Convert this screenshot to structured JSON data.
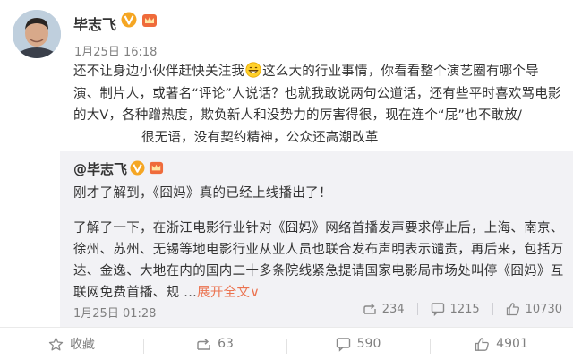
{
  "post": {
    "author": "毕志飞",
    "time": "1月25日 16:18",
    "text_part1": "还不让身边小伙伴赶快关注我",
    "text_part2": "这么大的行业事情，你看看整个演艺圈有哪个导演、制片人，或著名“评论”人说话？也就我敢说两句公道话，还有些平时喜欢骂电影的大V，各种蹭热度，欺负新人和没势力的厉害得很，现在连个“屁”也不敢放/",
    "text_part3": "很无语，没有契约精神，公众还高潮改革",
    "emoji": "grin-emoji"
  },
  "repost": {
    "author": "@毕志飞",
    "line1": "刚才了解到，《囧妈》真的已经上线播出了！",
    "paragraph": "了解了一下，在浙江电影行业针对《囧妈》网络首播发声要求停止后，上海、南京、徐州、苏州、无锡等地电影行业从业人员也联合发布声明表示谴责，再后来，包括万达、金逸、大地在内的国内二十多条院线紧急提请国家电影局市场处叫停《囧妈》互联网免费首播、规 ...",
    "expand_label": "展开全文",
    "expand_arrow": "∨",
    "time": "1月25日 01:28",
    "stats": {
      "reposts": "234",
      "comments": "1215",
      "likes": "10730"
    }
  },
  "actions": {
    "collect_label": "收藏",
    "repost_count": "63",
    "comment_count": "590",
    "like_count": "4901"
  },
  "colors": {
    "accent": "#eb7350",
    "v_badge": "#f5a623",
    "muted": "#808080",
    "repost_bg": "#f2f2f5"
  }
}
